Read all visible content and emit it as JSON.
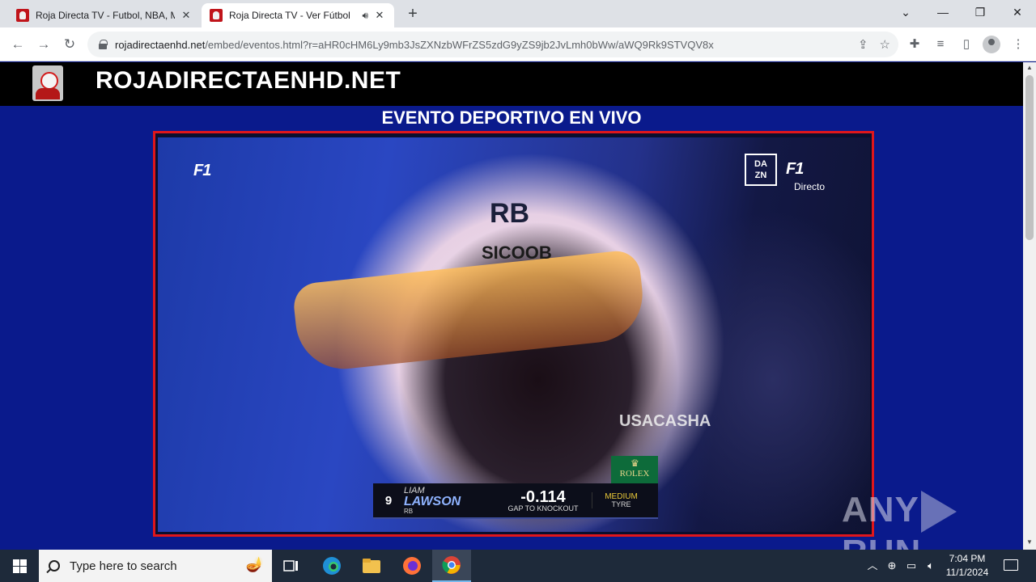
{
  "browser": {
    "tabs": [
      {
        "title": "Roja Directa TV - Futbol, NBA, M",
        "active": false,
        "audio": false
      },
      {
        "title": "Roja Directa TV - Ver Fútbol",
        "active": true,
        "audio": true
      }
    ],
    "new_tab_icon": "plus-icon",
    "window_controls": [
      "chevron-down-icon",
      "minimize-icon",
      "restore-icon",
      "close-icon"
    ],
    "url_host": "rojadirectaenhd.net",
    "url_path": "/embed/eventos.html?r=aHR0cHM6Ly9mb3JsZXNzbWFrZS5zdG9yZS9jb2JvLmh0bWw/aWQ9Rk9STVQV8x"
  },
  "site": {
    "name": "ROJADIRECTAENHD.NET",
    "event_title": "EVENTO DEPORTIVO EN VIVO"
  },
  "video": {
    "broadcaster": "DAZN",
    "status": "Directo",
    "helmet_text": "RB",
    "helmet_sponsor": "SICOOB",
    "side_text": "USACASHA",
    "sponsor_badge": "ROLEX",
    "lower_third": {
      "number": "9",
      "first_name": "LIAM",
      "last_name": "LAWSON",
      "team": "RB",
      "gap_value": "-0.114",
      "gap_label": "GAP TO KNOCKOUT",
      "tyre_compound": "MEDIUM",
      "tyre_label": "TYRE"
    }
  },
  "watermark": {
    "text_left": "ANY",
    "text_right": "RUN"
  },
  "taskbar": {
    "search_placeholder": "Type here to search",
    "time": "7:04 PM",
    "date": "11/1/2024"
  },
  "colors": {
    "page_bg": "#0a1a8c",
    "header_bg": "#000000",
    "player_border": "#e0161c",
    "taskbar_bg": "#1e2a3a"
  }
}
